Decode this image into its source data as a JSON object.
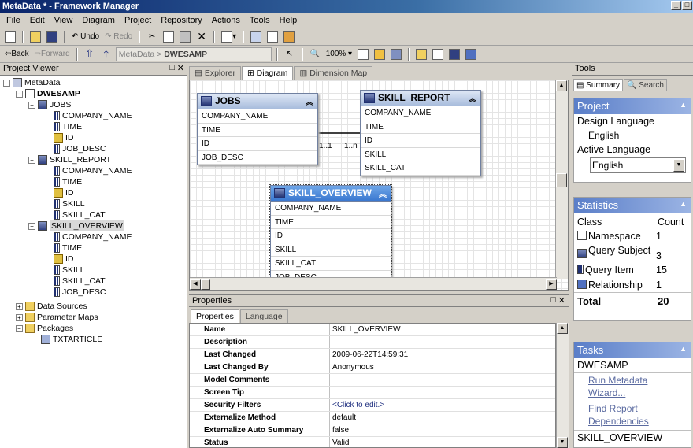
{
  "window": {
    "title": "MetaData * - Framework Manager"
  },
  "menu": [
    "File",
    "Edit",
    "View",
    "Diagram",
    "Project",
    "Repository",
    "Actions",
    "Tools",
    "Help"
  ],
  "toolbar": {
    "undo": "Undo",
    "redo": "Redo"
  },
  "nav": {
    "back": "Back",
    "forward": "Forward",
    "breadcrumb_root": "MetaData",
    "breadcrumb_sep": ">",
    "breadcrumb_current": "DWESAMP",
    "zoom": "100%"
  },
  "project_viewer": {
    "title": "Project Viewer",
    "nodes": [
      "MetaData",
      "DWESAMP",
      "JOBS",
      "COMPANY_NAME",
      "TIME",
      "ID",
      "JOB_DESC",
      "SKILL_REPORT",
      "COMPANY_NAME",
      "TIME",
      "ID",
      "SKILL",
      "SKILL_CAT",
      "SKILL_OVERVIEW",
      "COMPANY_NAME",
      "TIME",
      "ID",
      "SKILL",
      "SKILL_CAT",
      "JOB_DESC",
      "Data Sources",
      "Parameter Maps",
      "Packages",
      "TXTARTICLE"
    ]
  },
  "diagram_tabs": [
    "Explorer",
    "Diagram",
    "Dimension Map"
  ],
  "diagram": {
    "jobs": {
      "name": "JOBS",
      "fields": [
        "COMPANY_NAME",
        "TIME",
        "ID",
        "JOB_DESC"
      ]
    },
    "skill_report": {
      "name": "SKILL_REPORT",
      "fields": [
        "COMPANY_NAME",
        "TIME",
        "ID",
        "SKILL",
        "SKILL_CAT"
      ]
    },
    "skill_overview": {
      "name": "SKILL_OVERVIEW",
      "fields": [
        "COMPANY_NAME",
        "TIME",
        "ID",
        "SKILL",
        "SKILL_CAT",
        "JOB_DESC"
      ]
    },
    "card_left": "1..1",
    "card_right": "1..n"
  },
  "properties": {
    "title": "Properties",
    "tabs": [
      "Properties",
      "Language"
    ],
    "rows": [
      {
        "k": "Name",
        "v": "SKILL_OVERVIEW"
      },
      {
        "k": "Description",
        "v": ""
      },
      {
        "k": "Last Changed",
        "v": "2009-06-22T14:59:31"
      },
      {
        "k": "Last Changed By",
        "v": "Anonymous"
      },
      {
        "k": "Model Comments",
        "v": ""
      },
      {
        "k": "Screen Tip",
        "v": ""
      },
      {
        "k": "Security Filters",
        "v": "<Click to edit.>"
      },
      {
        "k": "Externalize Method",
        "v": "default"
      },
      {
        "k": "Externalize Auto Summary",
        "v": "false"
      },
      {
        "k": "Status",
        "v": "Valid"
      }
    ]
  },
  "tools": {
    "title": "Tools",
    "tab_summary": "Summary",
    "tab_search": "Search",
    "project_head": "Project",
    "design_language_label": "Design Language",
    "design_language": "English",
    "active_language_label": "Active Language",
    "active_language": "English",
    "stats_head": "Statistics",
    "class_col": "Class",
    "count_col": "Count",
    "stats": [
      {
        "c": "Namespace",
        "n": "1"
      },
      {
        "c": "Query Subject",
        "n": "3"
      },
      {
        "c": "Query Item",
        "n": "15"
      },
      {
        "c": "Relationship",
        "n": "1"
      }
    ],
    "total_label": "Total",
    "total": "20",
    "tasks_head": "Tasks",
    "task_group": "DWESAMP",
    "task_link1": "Run Metadata Wizard...",
    "task_link2": "Find Report Dependencies",
    "task_group2": "SKILL_OVERVIEW"
  }
}
